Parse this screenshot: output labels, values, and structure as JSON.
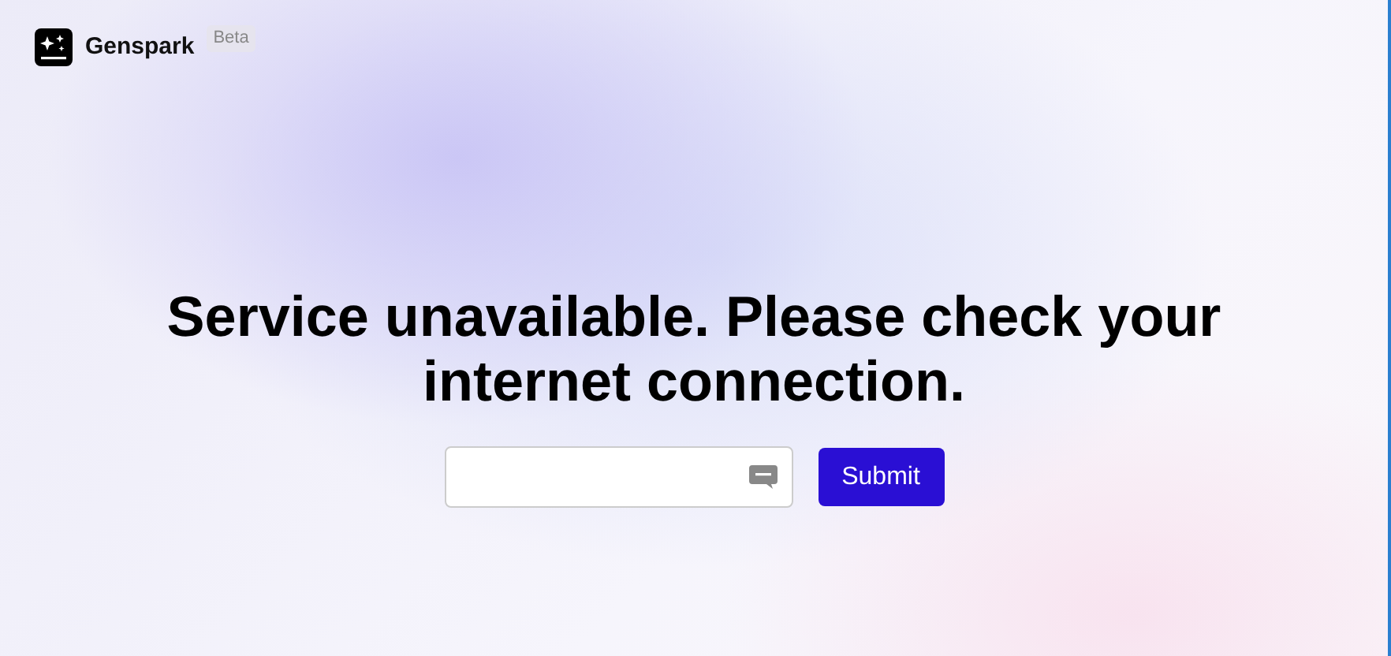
{
  "brand": {
    "name": "Genspark",
    "badge": "Beta"
  },
  "message": "Service unavailable. Please check your internet connection.",
  "form": {
    "submit": "Submit"
  }
}
